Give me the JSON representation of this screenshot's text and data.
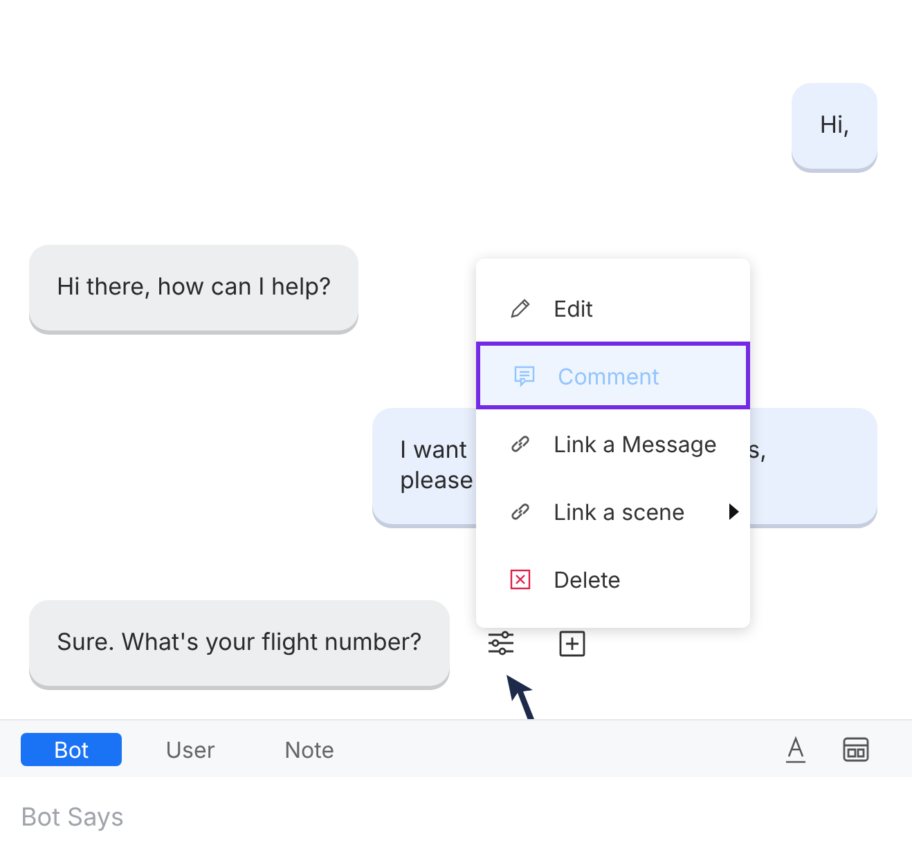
{
  "messages": [
    {
      "kind": "user",
      "lines": [
        {
          "left": "Hi,"
        }
      ]
    },
    {
      "kind": "bot",
      "lines": [
        {
          "left": "Hi there, how can I help?"
        }
      ]
    },
    {
      "kind": "user",
      "lines": [
        {
          "left": "I want",
          "right": "s,"
        },
        {
          "left": "please"
        }
      ]
    },
    {
      "kind": "bot",
      "lines": [
        {
          "left": "Sure. What's your flight number?"
        }
      ]
    }
  ],
  "context_menu": {
    "items": [
      {
        "kind": "edit",
        "label": "Edit",
        "selected": false,
        "submenu": false
      },
      {
        "kind": "comment",
        "label": "Comment",
        "selected": true,
        "submenu": false
      },
      {
        "kind": "link",
        "label": "Link a Message",
        "selected": false,
        "submenu": false
      },
      {
        "kind": "link",
        "label": "Link a scene",
        "selected": false,
        "submenu": true
      },
      {
        "kind": "delete",
        "label": "Delete",
        "selected": false,
        "submenu": false
      }
    ]
  },
  "composer": {
    "tabs": [
      {
        "label": "Bot",
        "selected": true
      },
      {
        "label": "User",
        "selected": false
      },
      {
        "label": "Note",
        "selected": false
      }
    ],
    "placeholder": "Bot Says"
  }
}
